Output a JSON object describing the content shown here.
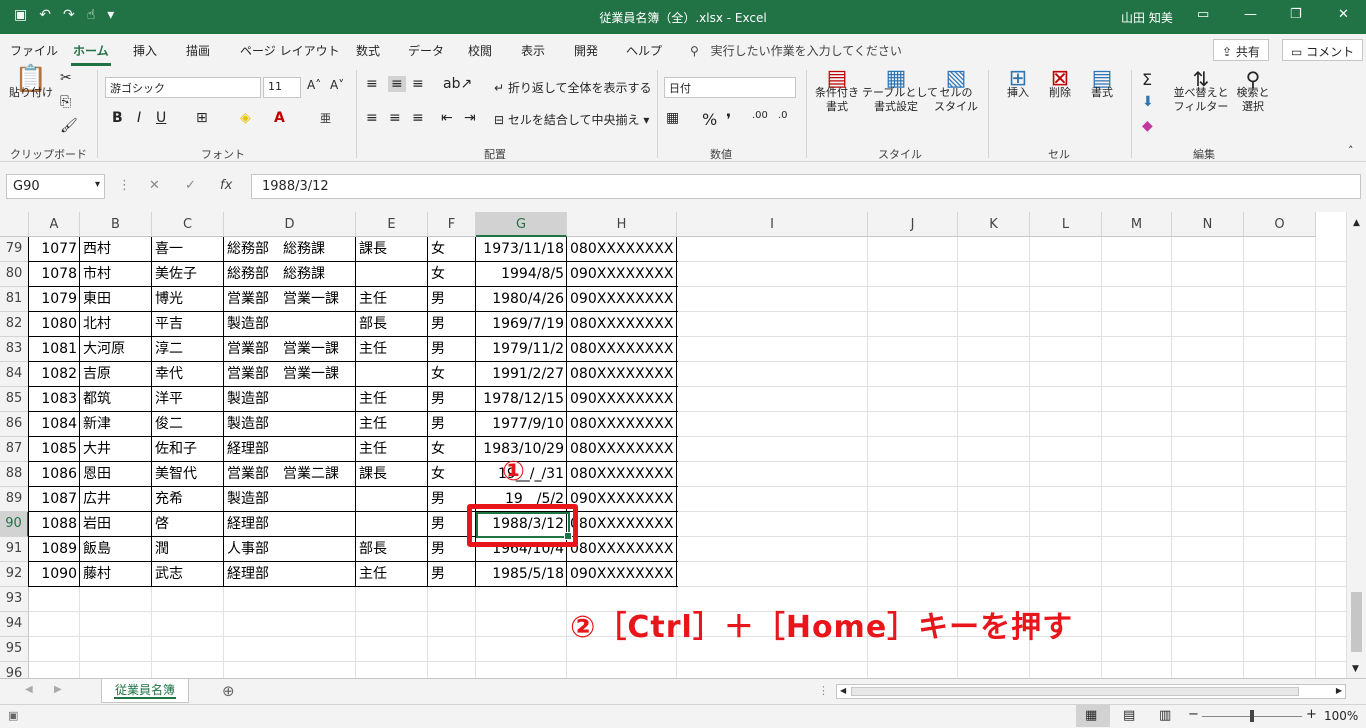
{
  "titlebar": {
    "title": "従業員名簿（全）.xlsx  -  Excel",
    "user": "山田 知美",
    "colors": {
      "bg": "#217346"
    }
  },
  "menu": {
    "tabs": [
      "ファイル",
      "ホーム",
      "挿入",
      "描画",
      "ページ レイアウト",
      "数式",
      "データ",
      "校閲",
      "表示",
      "開発",
      "ヘルプ"
    ],
    "active_tab": "ホーム",
    "tell_me": "実行したい作業を入力してください",
    "share": "共有",
    "comment": "コメント"
  },
  "ribbon": {
    "clipboard": {
      "paste": "貼り付け",
      "label": "クリップボード"
    },
    "font": {
      "name": "游ゴシック",
      "size": "11",
      "label": "フォント",
      "bold": "B",
      "italic": "I",
      "underline": "U"
    },
    "alignment": {
      "wrap": "折り返して全体を表示する",
      "merge": "セルを結合して中央揃え",
      "label": "配置"
    },
    "number": {
      "format": "日付",
      "label": "数値"
    },
    "styles": {
      "conditional": "条件付き\n書式",
      "table": "テーブルとして\n書式設定",
      "cellstyle": "セルの\nスタイル",
      "label": "スタイル"
    },
    "cells": {
      "insert": "挿入",
      "delete": "削除",
      "format": "書式",
      "label": "セル"
    },
    "editing": {
      "sort": "並べ替えと\nフィルター",
      "find": "検索と\n選択",
      "label": "編集"
    }
  },
  "formula": {
    "namebox": "G90",
    "value": "1988/3/12"
  },
  "columns": [
    "A",
    "B",
    "C",
    "D",
    "E",
    "F",
    "G",
    "H",
    "I",
    "J",
    "K",
    "L",
    "M",
    "N",
    "O"
  ],
  "selected_col": "G",
  "selected_row": "90",
  "rows": [
    {
      "n": "79",
      "A": "1077",
      "B": "西村",
      "C": "喜一",
      "D": "総務部　総務課",
      "E": "課長",
      "F": "女",
      "G": "1973/11/18",
      "H": "080XXXXXXXX"
    },
    {
      "n": "80",
      "A": "1078",
      "B": "市村",
      "C": "美佐子",
      "D": "総務部　総務課",
      "E": "",
      "F": "女",
      "G": "1994/8/5",
      "H": "090XXXXXXXX"
    },
    {
      "n": "81",
      "A": "1079",
      "B": "東田",
      "C": "博光",
      "D": "営業部　営業一課",
      "E": "主任",
      "F": "男",
      "G": "1980/4/26",
      "H": "090XXXXXXXX"
    },
    {
      "n": "82",
      "A": "1080",
      "B": "北村",
      "C": "平吉",
      "D": "製造部",
      "E": "部長",
      "F": "男",
      "G": "1969/7/19",
      "H": "080XXXXXXXX"
    },
    {
      "n": "83",
      "A": "1081",
      "B": "大河原",
      "C": "淳二",
      "D": "営業部　営業一課",
      "E": "主任",
      "F": "男",
      "G": "1979/11/2",
      "H": "080XXXXXXXX"
    },
    {
      "n": "84",
      "A": "1082",
      "B": "吉原",
      "C": "幸代",
      "D": "営業部　営業一課",
      "E": "",
      "F": "女",
      "G": "1991/2/27",
      "H": "080XXXXXXXX"
    },
    {
      "n": "85",
      "A": "1083",
      "B": "都筑",
      "C": "洋平",
      "D": "製造部",
      "E": "主任",
      "F": "男",
      "G": "1978/12/15",
      "H": "090XXXXXXXX"
    },
    {
      "n": "86",
      "A": "1084",
      "B": "新津",
      "C": "俊二",
      "D": "製造部",
      "E": "主任",
      "F": "男",
      "G": "1977/9/10",
      "H": "080XXXXXXXX"
    },
    {
      "n": "87",
      "A": "1085",
      "B": "大井",
      "C": "佐和子",
      "D": "経理部",
      "E": "主任",
      "F": "女",
      "G": "1983/10/29",
      "H": "080XXXXXXXX"
    },
    {
      "n": "88",
      "A": "1086",
      "B": "恩田",
      "C": "美智代",
      "D": "営業部　営業二課",
      "E": "課長",
      "F": "女",
      "G": "19__/_/31",
      "H": "080XXXXXXXX"
    },
    {
      "n": "89",
      "A": "1087",
      "B": "広井",
      "C": "充希",
      "D": "製造部",
      "E": "",
      "F": "男",
      "G": "19__/5/2",
      "H": "090XXXXXXXX"
    },
    {
      "n": "90",
      "A": "1088",
      "B": "岩田",
      "C": "啓",
      "D": "経理部",
      "E": "",
      "F": "男",
      "G": "1988/3/12",
      "H": "080XXXXXXXX"
    },
    {
      "n": "91",
      "A": "1089",
      "B": "飯島",
      "C": "潤",
      "D": "人事部",
      "E": "部長",
      "F": "男",
      "G": "1964/10/4",
      "H": "080XXXXXXXX"
    },
    {
      "n": "92",
      "A": "1090",
      "B": "藤村",
      "C": "武志",
      "D": "経理部",
      "E": "主任",
      "F": "男",
      "G": "1985/5/18",
      "H": "090XXXXXXXX"
    },
    {
      "n": "93"
    },
    {
      "n": "94"
    },
    {
      "n": "95"
    },
    {
      "n": "96"
    }
  ],
  "annotations": {
    "step1": "①",
    "step2": "②［Ctrl］＋［Home］キーを押す",
    "color": "#e8151b"
  },
  "sheet_tab": "従業員名簿",
  "zoom": "100%"
}
